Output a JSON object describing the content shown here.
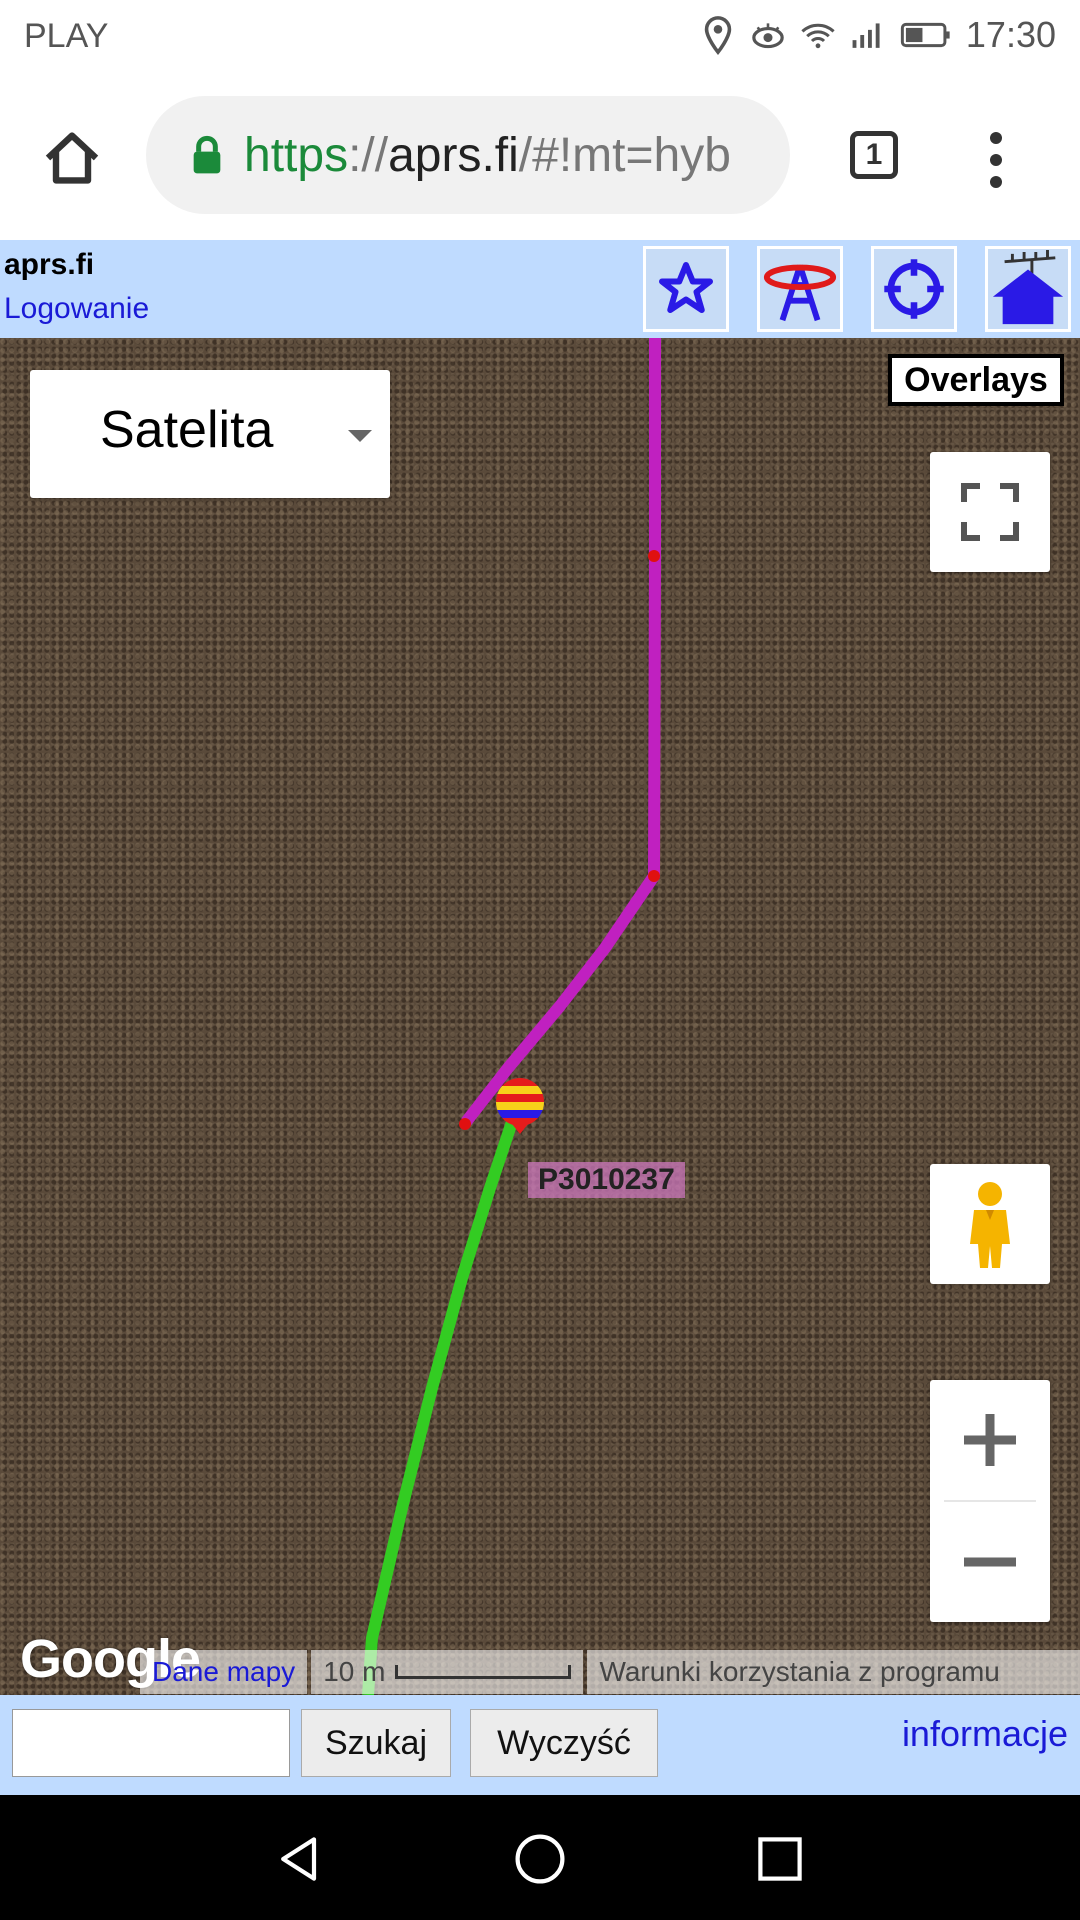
{
  "status_bar": {
    "carrier": "PLAY",
    "time": "17:30"
  },
  "browser": {
    "url_scheme": "https",
    "url_sep": "://",
    "url_host": "aprs.fi",
    "url_rest": "/#!mt=hyb",
    "tab_count": "1"
  },
  "header": {
    "site_title": "aprs.fi",
    "login_label": "Logowanie",
    "toolbar_icons": [
      "star-icon",
      "tower-icon",
      "crosshair-icon",
      "house-antenna-icon"
    ]
  },
  "map": {
    "layer_select_label": "Satelita",
    "overlays_label": "Overlays",
    "station_label": "P3010237",
    "google_logo": "Google",
    "map_data_link": "Dane mapy",
    "scale_label": "10 m",
    "terms_link": "Warunki korzystania z programu",
    "track_colors": {
      "purple": "#c020c0",
      "green": "#33cc22",
      "point": "#e01010"
    }
  },
  "search": {
    "input_value": "",
    "search_button": "Szukaj",
    "clear_button": "Wyczyść",
    "info_link": "informacje"
  },
  "colors": {
    "header_bg": "#bfdbff",
    "link": "#1a1ad6",
    "url_green": "#1b8a3a"
  }
}
